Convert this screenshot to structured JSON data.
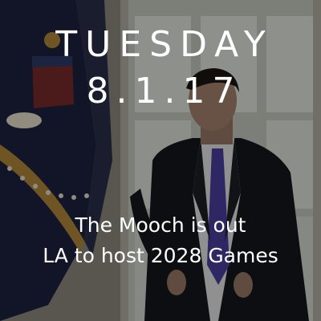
{
  "graphic": {
    "day": "TUESDAY",
    "date": "8.1.17",
    "headlines": [
      "The Mooch is out",
      "LA to host 2028 Games"
    ]
  },
  "colors": {
    "text": "#ffffff",
    "overlay": "rgba(0,0,0,0.38)",
    "suit": "#15171c",
    "tie": "#4b3fa0",
    "flag_navy": "#1c2340",
    "flag_red": "#7a2a2a",
    "gold_fringe": "#b58a3a",
    "window": "#cfd3c8"
  }
}
